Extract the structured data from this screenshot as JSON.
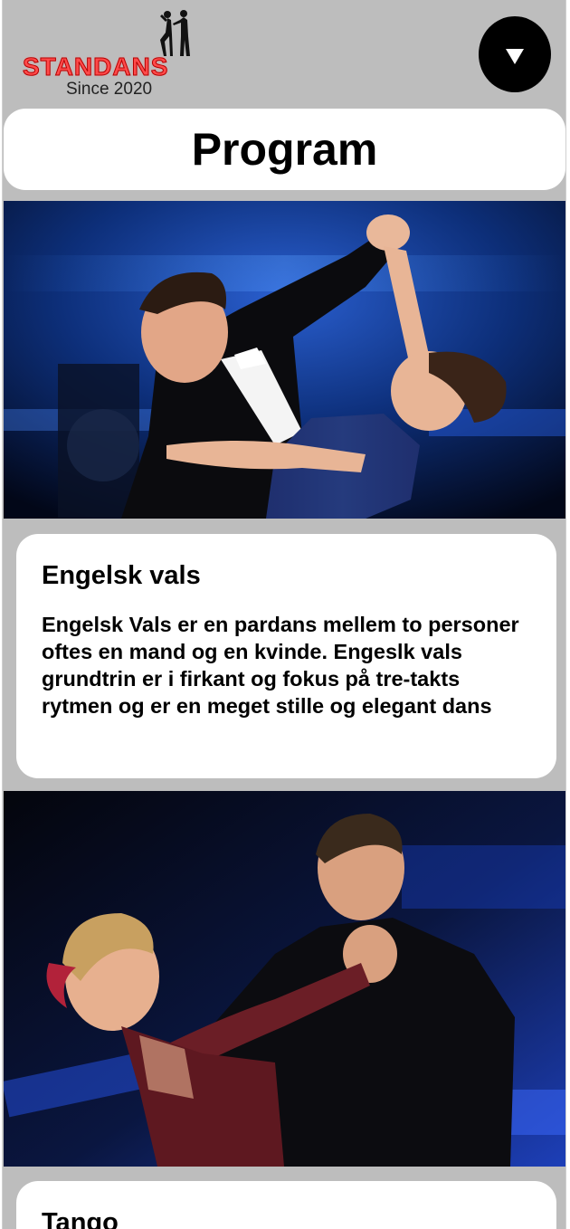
{
  "header": {
    "logo_word": "STANDANS",
    "logo_since": "Since 2020",
    "menu_icon": "triangle-down-icon"
  },
  "page": {
    "title": "Program"
  },
  "dances": [
    {
      "name": "Engelsk vals",
      "description": "Engelsk Vals er en pardans mellem to personer oftes en mand og en kvinde. Engeslk vals grundtrin er i firkant og fokus på tre-takts rytmen og er en meget stille og elegant dans"
    },
    {
      "name": "Tango",
      "description": ""
    }
  ],
  "colors": {
    "page_background": "#bdbdbd",
    "card_background": "#ffffff",
    "logo_red": "#ff4a4a",
    "menu_button": "#000000"
  }
}
